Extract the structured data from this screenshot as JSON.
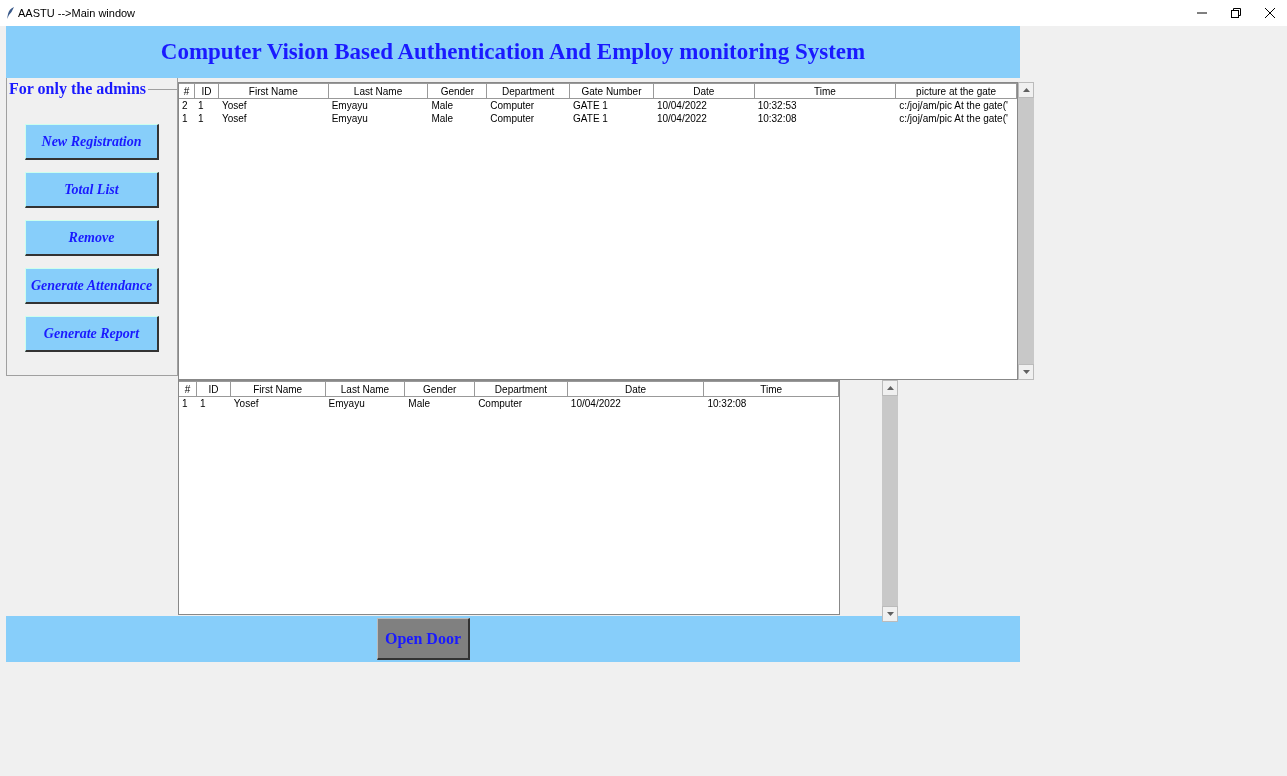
{
  "window": {
    "title": "AASTU -->Main window"
  },
  "header": {
    "title": "Computer Vision Based Authentication And Employ monitoring System"
  },
  "admin_panel": {
    "title": "For only the admins",
    "buttons": [
      "New Registration",
      "Total List",
      "Remove",
      "Generate Attendance",
      "Generate Report"
    ]
  },
  "gate_table": {
    "columns": [
      "#",
      "ID",
      "First Name",
      "Last Name",
      "Gender",
      "Department",
      "Gate Number",
      "Date",
      "Time",
      "picture at the gate"
    ],
    "rows": [
      [
        "2",
        "1",
        "Yosef",
        "Emyayu",
        "Male",
        "Computer",
        "GATE 1",
        "10/04/2022",
        "10:32:53",
        "c:/joj/am/pic At the gate('"
      ],
      [
        "1",
        "1",
        "Yosef",
        "Emyayu",
        "Male",
        "Computer",
        "GATE 1",
        "10/04/2022",
        "10:32:08",
        "c:/joj/am/pic At the gate('"
      ]
    ]
  },
  "attendance_table": {
    "columns": [
      "#",
      "ID",
      "First Name",
      "Last Name",
      "Gender",
      "Department",
      "Date",
      "Time"
    ],
    "rows": [
      [
        "1",
        "1",
        "Yosef",
        "Emyayu",
        "Male",
        "Computer",
        "10/04/2022",
        "10:32:08"
      ]
    ]
  },
  "footer": {
    "button": "Open Door"
  }
}
